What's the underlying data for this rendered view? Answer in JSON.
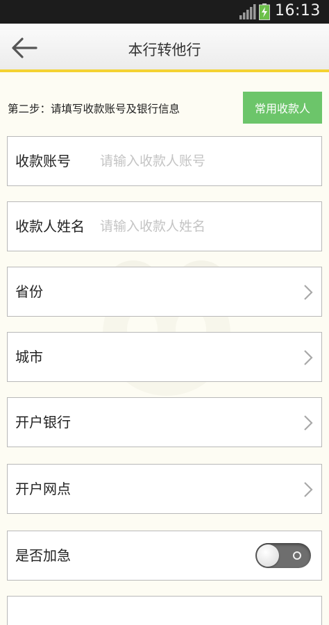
{
  "status_bar": {
    "time": "16:13",
    "icons": [
      "signal-icon",
      "battery-charging-icon"
    ],
    "battery_color": "#6cc04a"
  },
  "header": {
    "title": "本行转他行",
    "back_icon": "arrow-left-icon",
    "accent_color": "#f4d232"
  },
  "step": {
    "text": "第二步：请填写收款账号及银行信息",
    "common_payee_button": "常用收款人",
    "button_color": "#6cc56a"
  },
  "form": {
    "account": {
      "label": "收款账号",
      "placeholder": "请输入收款人账号",
      "value": ""
    },
    "name": {
      "label": "收款人姓名",
      "placeholder": "请输入收款人姓名",
      "value": ""
    },
    "province": {
      "label": "省份"
    },
    "city": {
      "label": "城市"
    },
    "bank": {
      "label": "开户银行"
    },
    "branch": {
      "label": "开户网点"
    },
    "urgent": {
      "label": "是否加急",
      "enabled": false
    }
  }
}
